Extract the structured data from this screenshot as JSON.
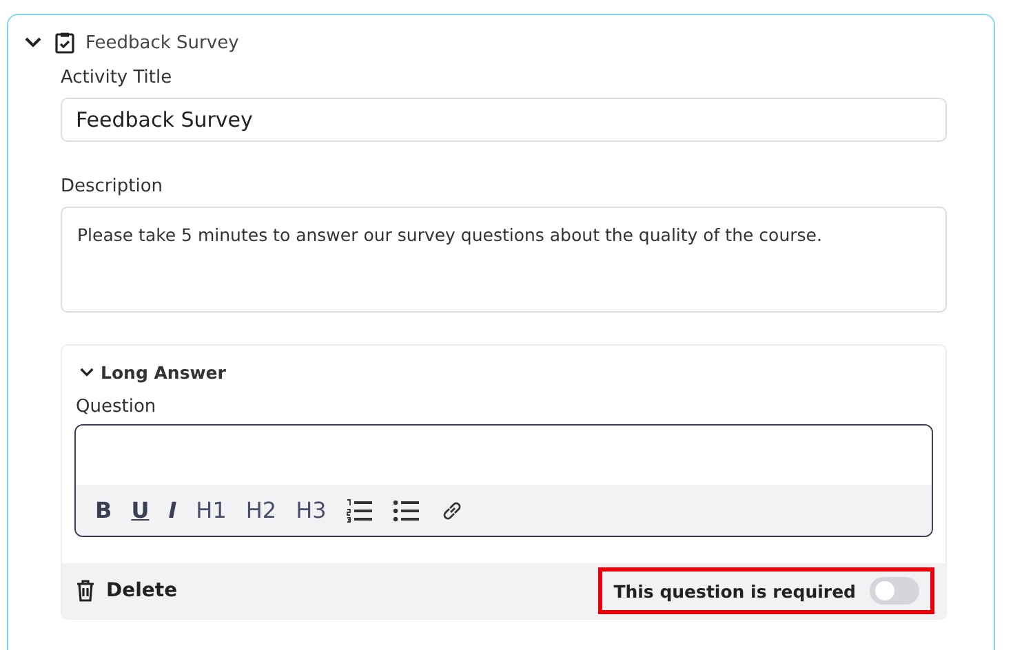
{
  "activity": {
    "title": "Feedback Survey",
    "expanded": true
  },
  "title_field": {
    "label": "Activity Title",
    "value": "Feedback Survey"
  },
  "description_field": {
    "label": "Description",
    "value": "Please take 5 minutes to answer our survey questions about the quality of the course."
  },
  "question_card": {
    "type": "Long Answer",
    "expanded": true,
    "question_label": "Question",
    "toolbar": [
      {
        "kind": "bold",
        "label": "B"
      },
      {
        "kind": "underline",
        "label": "U"
      },
      {
        "kind": "italic",
        "label": "I"
      },
      {
        "kind": "heading",
        "label": "H1"
      },
      {
        "kind": "heading",
        "label": "H2"
      },
      {
        "kind": "heading",
        "label": "H3"
      },
      {
        "kind": "ordered-list"
      },
      {
        "kind": "bullet-list"
      },
      {
        "kind": "link"
      }
    ],
    "delete_label": "Delete",
    "required_label": "This question is required",
    "required": false,
    "highlighted": true
  }
}
